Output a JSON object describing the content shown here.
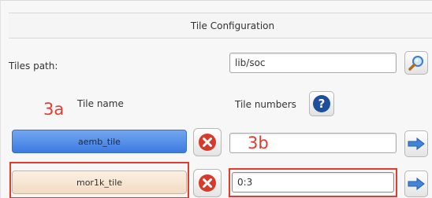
{
  "panel": {
    "title": "Tile Configuration"
  },
  "tiles_path": {
    "label": "Tiles path:",
    "value": "lib/soc",
    "browse_icon": "magnifier-icon"
  },
  "columns": {
    "tile_name": "Tile name",
    "tile_numbers": "Tile numbers",
    "help_icon": "help-icon"
  },
  "rows": [
    {
      "tile_name": "aemb_tile",
      "tile_numbers": "",
      "remove_icon": "remove-icon",
      "next_icon": "arrow-right-icon",
      "selected": true
    },
    {
      "tile_name": "mor1k_tile",
      "tile_numbers": "0:3",
      "remove_icon": "remove-icon",
      "next_icon": "arrow-right-icon",
      "selected": false
    }
  ],
  "annotations": {
    "a": "3a",
    "b": "3b"
  },
  "colors": {
    "annotation_red": "#e53a2e",
    "selected_blue": "#3c7be0",
    "tile_beige": "#f2dcc4",
    "help_blue": "#1d4f9c",
    "remove_red": "#d63a2a",
    "arrow_blue": "#3f86d9"
  }
}
